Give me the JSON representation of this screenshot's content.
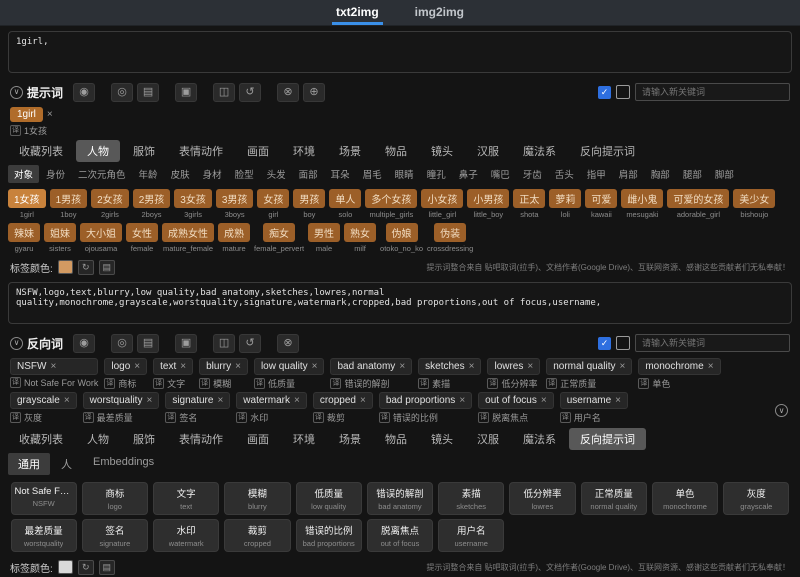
{
  "glyphs": {
    "close": "×",
    "check": "✓",
    "chevron_down": "∨",
    "trans_badge": "译"
  },
  "header": {
    "tabs": [
      {
        "label": "txt2img",
        "active": true
      },
      {
        "label": "img2img",
        "active": false
      }
    ]
  },
  "positive": {
    "prompt_value": "1girl,",
    "toolbar_label": "提示词",
    "keyword_placeholder": "请输入新关键词",
    "toolbar_icons": [
      {
        "name": "settings-icon",
        "glyph": "◉"
      },
      {
        "name": "theme-icon",
        "glyph": "◎"
      },
      {
        "name": "save-icon",
        "glyph": "▤"
      },
      {
        "name": "notebook-icon",
        "glyph": "▣"
      },
      {
        "name": "image-icon",
        "glyph": "◫"
      },
      {
        "name": "history-icon",
        "glyph": "↺"
      },
      {
        "name": "delete-icon",
        "glyph": "⊗"
      },
      {
        "name": "translate-icon",
        "glyph": "⊕"
      }
    ],
    "selected_chips": [
      {
        "text": "1girl",
        "translation": "1女孩"
      }
    ],
    "tag_color_label": "标签颜色:",
    "tag_color": "#d29a62"
  },
  "category_tabs_top": [
    {
      "label": "收藏列表",
      "active": false
    },
    {
      "label": "人物",
      "active": true
    },
    {
      "label": "服饰",
      "active": false
    },
    {
      "label": "表情动作",
      "active": false
    },
    {
      "label": "画面",
      "active": false
    },
    {
      "label": "环境",
      "active": false
    },
    {
      "label": "场景",
      "active": false
    },
    {
      "label": "物品",
      "active": false
    },
    {
      "label": "镜头",
      "active": false
    },
    {
      "label": "汉服",
      "active": false
    },
    {
      "label": "魔法系",
      "active": false
    },
    {
      "label": "反向提示词",
      "active": false
    }
  ],
  "sub_tabs_top": [
    {
      "label": "对象",
      "active": true
    },
    {
      "label": "身份",
      "active": false
    },
    {
      "label": "二次元角色",
      "active": false
    },
    {
      "label": "年龄",
      "active": false
    },
    {
      "label": "皮肤",
      "active": false
    },
    {
      "label": "身材",
      "active": false
    },
    {
      "label": "脸型",
      "active": false
    },
    {
      "label": "头发",
      "active": false
    },
    {
      "label": "面部",
      "active": false
    },
    {
      "label": "耳朵",
      "active": false
    },
    {
      "label": "眉毛",
      "active": false
    },
    {
      "label": "眼睛",
      "active": false
    },
    {
      "label": "瞳孔",
      "active": false
    },
    {
      "label": "鼻子",
      "active": false
    },
    {
      "label": "嘴巴",
      "active": false
    },
    {
      "label": "牙齿",
      "active": false
    },
    {
      "label": "舌头",
      "active": false
    },
    {
      "label": "指甲",
      "active": false
    },
    {
      "label": "肩部",
      "active": false
    },
    {
      "label": "胸部",
      "active": false
    },
    {
      "label": "腿部",
      "active": false
    },
    {
      "label": "脚部",
      "active": false
    }
  ],
  "positive_tags": [
    {
      "zh": "1女孩",
      "en": "1girl",
      "selected": true
    },
    {
      "zh": "1男孩",
      "en": "1boy"
    },
    {
      "zh": "2女孩",
      "en": "2girls"
    },
    {
      "zh": "2男孩",
      "en": "2boys"
    },
    {
      "zh": "3女孩",
      "en": "3girls"
    },
    {
      "zh": "3男孩",
      "en": "3boys"
    },
    {
      "zh": "女孩",
      "en": "girl"
    },
    {
      "zh": "男孩",
      "en": "boy"
    },
    {
      "zh": "单人",
      "en": "solo"
    },
    {
      "zh": "多个女孩",
      "en": "multiple_girls"
    },
    {
      "zh": "小女孩",
      "en": "little_girl"
    },
    {
      "zh": "小男孩",
      "en": "little_boy"
    },
    {
      "zh": "正太",
      "en": "shota"
    },
    {
      "zh": "萝莉",
      "en": "loli"
    },
    {
      "zh": "可爱",
      "en": "kawaii"
    },
    {
      "zh": "雌小鬼",
      "en": "mesugaki"
    },
    {
      "zh": "可爱的女孩",
      "en": "adorable_girl"
    },
    {
      "zh": "美少女",
      "en": "bishoujo"
    },
    {
      "zh": "辣妹",
      "en": "gyaru"
    },
    {
      "zh": "姐妹",
      "en": "sisters"
    },
    {
      "zh": "大小姐",
      "en": "ojousama"
    },
    {
      "zh": "女性",
      "en": "female"
    },
    {
      "zh": "成熟女性",
      "en": "mature_female"
    },
    {
      "zh": "成熟",
      "en": "mature"
    },
    {
      "zh": "痴女",
      "en": "female_pervert"
    },
    {
      "zh": "男性",
      "en": "male"
    },
    {
      "zh": "熟女",
      "en": "milf"
    },
    {
      "zh": "伪娘",
      "en": "otoko_no_ko"
    },
    {
      "zh": "伪装",
      "en": "crossdressing"
    }
  ],
  "footer_note": "提示词整合来自 贴吧取词(拉手)、文档作者(Google Drive)、互联网资源、感谢这些贡献者们无私奉献！",
  "negative": {
    "prompt_value": "NSFW,logo,text,blurry,low quality,bad anatomy,sketches,lowres,normal quality,monochrome,grayscale,worstquality,signature,watermark,cropped,bad proportions,out of focus,username,",
    "toolbar_label": "反向词",
    "keyword_placeholder": "请输入新关键词",
    "toolbar_icons": [
      {
        "name": "settings-icon",
        "glyph": "◉"
      },
      {
        "name": "theme-icon",
        "glyph": "◎"
      },
      {
        "name": "save-icon",
        "glyph": "▤"
      },
      {
        "name": "notebook-icon",
        "glyph": "▣"
      },
      {
        "name": "image-icon",
        "glyph": "◫"
      },
      {
        "name": "history-icon",
        "glyph": "↺"
      },
      {
        "name": "delete-icon",
        "glyph": "⊗"
      }
    ],
    "tag_color_label": "标签颜色:",
    "tag_color": "#d9d9d9"
  },
  "negative_chips": [
    {
      "text": "NSFW",
      "translation": "Not Safe For Work"
    },
    {
      "text": "logo",
      "translation": "商标"
    },
    {
      "text": "text",
      "translation": "文字"
    },
    {
      "text": "blurry",
      "translation": "模糊"
    },
    {
      "text": "low quality",
      "translation": "低质量"
    },
    {
      "text": "bad anatomy",
      "translation": "错误的解剖"
    },
    {
      "text": "sketches",
      "translation": "素描"
    },
    {
      "text": "lowres",
      "translation": "低分辨率"
    },
    {
      "text": "normal quality",
      "translation": "正常质量"
    },
    {
      "text": "monochrome",
      "translation": "单色"
    },
    {
      "text": "grayscale",
      "translation": "灰度"
    },
    {
      "text": "worstquality",
      "translation": "最差质量"
    },
    {
      "text": "signature",
      "translation": "签名"
    },
    {
      "text": "watermark",
      "translation": "水印"
    },
    {
      "text": "cropped",
      "translation": "裁剪"
    },
    {
      "text": "bad proportions",
      "translation": "错误的比例"
    },
    {
      "text": "out of focus",
      "translation": "脱离焦点"
    },
    {
      "text": "username",
      "translation": "用户名"
    }
  ],
  "category_tabs_bottom": [
    {
      "label": "收藏列表",
      "active": false
    },
    {
      "label": "人物",
      "active": false
    },
    {
      "label": "服饰",
      "active": false
    },
    {
      "label": "表情动作",
      "active": false
    },
    {
      "label": "画面",
      "active": false
    },
    {
      "label": "环境",
      "active": false
    },
    {
      "label": "场景",
      "active": false
    },
    {
      "label": "物品",
      "active": false
    },
    {
      "label": "镜头",
      "active": false
    },
    {
      "label": "汉服",
      "active": false
    },
    {
      "label": "魔法系",
      "active": false
    },
    {
      "label": "反向提示词",
      "active": true
    }
  ],
  "sub_tabs_bottom": [
    {
      "label": "通用",
      "active": true
    },
    {
      "label": "人",
      "active": false
    },
    {
      "label": "Embeddings",
      "active": false
    }
  ],
  "negative_tags": [
    {
      "zh": "Not Safe For Work",
      "en": "NSFW"
    },
    {
      "zh": "商标",
      "en": "logo"
    },
    {
      "zh": "文字",
      "en": "text"
    },
    {
      "zh": "模糊",
      "en": "blurry"
    },
    {
      "zh": "低质量",
      "en": "low quality"
    },
    {
      "zh": "错误的解剖",
      "en": "bad anatomy"
    },
    {
      "zh": "素描",
      "en": "sketches"
    },
    {
      "zh": "低分辨率",
      "en": "lowres"
    },
    {
      "zh": "正常质量",
      "en": "normal quality"
    },
    {
      "zh": "单色",
      "en": "monochrome"
    },
    {
      "zh": "灰度",
      "en": "grayscale"
    },
    {
      "zh": "最差质量",
      "en": "worstquality"
    },
    {
      "zh": "签名",
      "en": "signature"
    },
    {
      "zh": "水印",
      "en": "watermark"
    },
    {
      "zh": "裁剪",
      "en": "cropped"
    },
    {
      "zh": "错误的比例",
      "en": "bad proportions"
    },
    {
      "zh": "脱离焦点",
      "en": "out of focus"
    },
    {
      "zh": "用户名",
      "en": "username"
    }
  ]
}
